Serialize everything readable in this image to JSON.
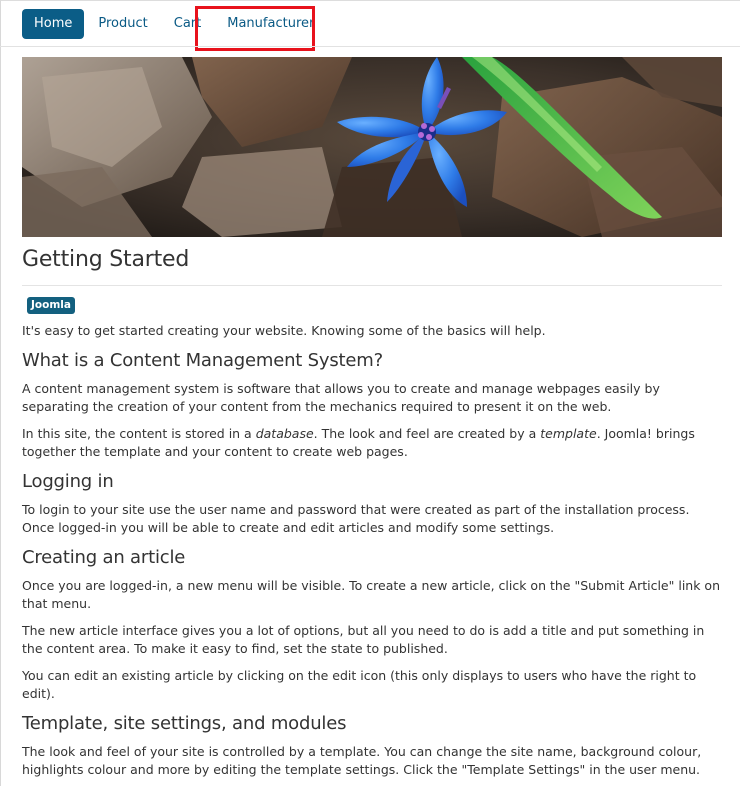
{
  "nav": {
    "items": [
      {
        "label": "Home",
        "active": true
      },
      {
        "label": "Product",
        "active": false
      },
      {
        "label": "Cart",
        "active": false
      },
      {
        "label": "Manufacturer",
        "active": false
      }
    ]
  },
  "banner": {
    "icon": "flower-photo"
  },
  "article": {
    "title": "Getting Started",
    "tag": "Joomla",
    "intro": "It's easy to get started creating your website. Knowing some of the basics will help.",
    "sections": [
      {
        "heading": "What is a Content Management System?",
        "p1": "A content management system is software that allows you to create and manage webpages easily by separating the creation of your content from the mechanics required to present it on the web.",
        "p2_a": "In this site, the content is stored in a ",
        "p2_em1": "database",
        "p2_b": ". The look and feel are created by a ",
        "p2_em2": "template",
        "p2_c": ". Joomla! brings together the template and your content to create web pages."
      },
      {
        "heading": "Logging in",
        "p1": "To login to your site use the user name and password that were created as part of the installation process. Once logged-in you will be able to create and edit articles and modify some settings."
      },
      {
        "heading": "Creating an article",
        "p1": "Once you are logged-in, a new menu will be visible. To create a new article, click on the \"Submit Article\" link on that menu.",
        "p2": "The new article interface gives you a lot of options, but all you need to do is add a title and put something in the content area. To make it easy to find, set the state to published.",
        "p3": "You can edit an existing article by clicking on the edit icon (this only displays to users who have the right to edit)."
      },
      {
        "heading": "Template, site settings, and modules",
        "p1": "The look and feel of your site is controlled by a template. You can change the site name, background colour, highlights colour and more by editing the template settings. Click the \"Template Settings\" in the user menu."
      }
    ]
  },
  "colors": {
    "nav_active_bg": "#0b5d87",
    "link": "#0a5a85",
    "highlight": "#e8121c",
    "tag_bg": "#13607f"
  }
}
